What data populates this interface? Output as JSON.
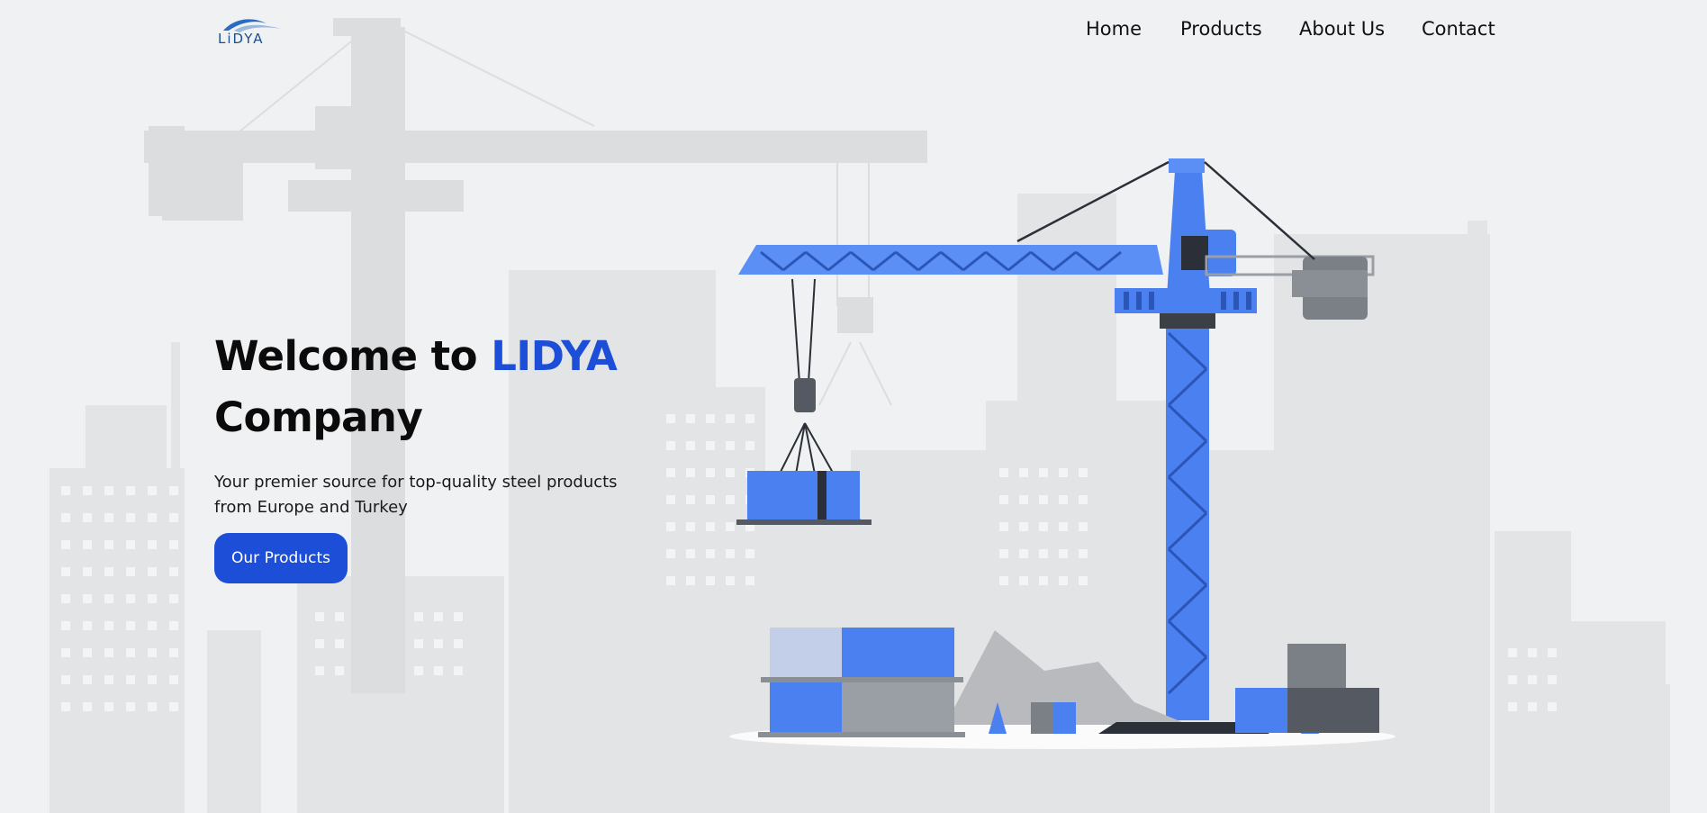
{
  "brand": {
    "logo_text": "LiDYA",
    "accent_color": "#1d4ed8"
  },
  "nav": {
    "items": [
      {
        "label": "Home"
      },
      {
        "label": "Products"
      },
      {
        "label": "About Us"
      },
      {
        "label": "Contact"
      }
    ]
  },
  "hero": {
    "title_prefix": "Welcome to",
    "title_brand": "LIDYA",
    "title_suffix": "Company",
    "subtitle": "Your premier source for top-quality steel products from Europe and Turkey",
    "cta_label": "Our Products"
  },
  "illustration": {
    "subject": "construction-crane-illustration",
    "crane_color": "#4a80f0"
  }
}
